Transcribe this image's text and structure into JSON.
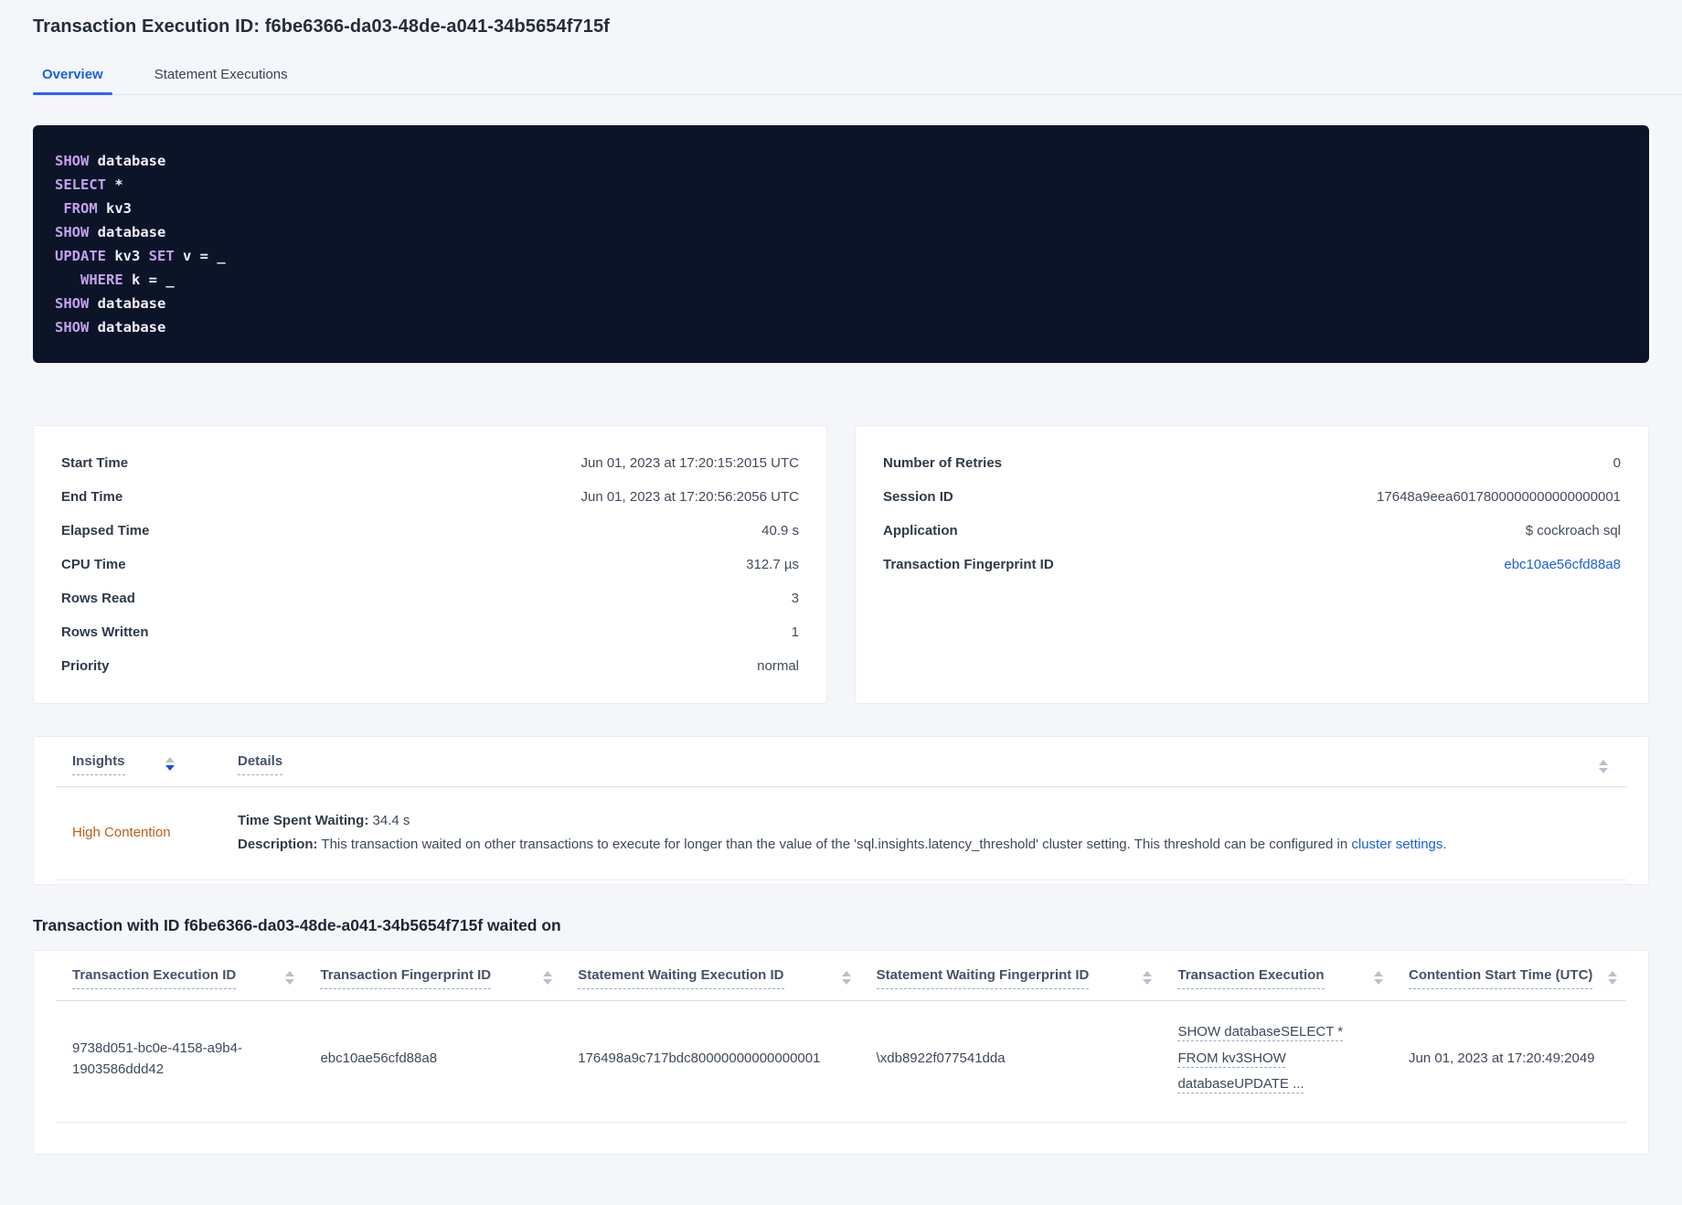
{
  "page": {
    "title": "Transaction Execution ID: f6be6366-da03-48de-a041-34b5654f715f"
  },
  "tabs": {
    "overview": "Overview",
    "statement_executions": "Statement Executions"
  },
  "sql": {
    "lines": [
      [
        {
          "t": "SHOW",
          "k": true
        },
        {
          "t": " database",
          "k": false
        }
      ],
      [
        {
          "t": "SELECT",
          "k": true
        },
        {
          "t": " *",
          "k": false
        }
      ],
      [
        {
          "t": " ",
          "k": false
        },
        {
          "t": "FROM",
          "k": true
        },
        {
          "t": " kv3",
          "k": false
        }
      ],
      [
        {
          "t": "SHOW",
          "k": true
        },
        {
          "t": " database",
          "k": false
        }
      ],
      [
        {
          "t": "UPDATE",
          "k": true
        },
        {
          "t": " kv3 ",
          "k": false
        },
        {
          "t": "SET",
          "k": true
        },
        {
          "t": " v = _",
          "k": false
        }
      ],
      [
        {
          "t": "   ",
          "k": false
        },
        {
          "t": "WHERE",
          "k": true
        },
        {
          "t": " k = _",
          "k": false
        }
      ],
      [
        {
          "t": "SHOW",
          "k": true
        },
        {
          "t": " database",
          "k": false
        }
      ],
      [
        {
          "t": "SHOW",
          "k": true
        },
        {
          "t": " database",
          "k": false
        }
      ]
    ]
  },
  "summary_left": {
    "rows": [
      {
        "label": "Start Time",
        "value": "Jun 01, 2023 at 17:20:15:2015 UTC"
      },
      {
        "label": "End Time",
        "value": "Jun 01, 2023 at 17:20:56:2056 UTC"
      },
      {
        "label": "Elapsed Time",
        "value": "40.9 s"
      },
      {
        "label": "CPU Time",
        "value": "312.7 µs"
      },
      {
        "label": "Rows Read",
        "value": "3"
      },
      {
        "label": "Rows Written",
        "value": "1"
      },
      {
        "label": "Priority",
        "value": "normal"
      }
    ]
  },
  "summary_right": {
    "rows": [
      {
        "label": "Number of Retries",
        "value": "0"
      },
      {
        "label": "Session ID",
        "value": "17648a9eea6017800000000000000001"
      },
      {
        "label": "Application",
        "value": "$ cockroach sql"
      },
      {
        "label": "Transaction Fingerprint ID",
        "value": "ebc10ae56cfd88a8"
      }
    ]
  },
  "insights_table": {
    "columns": {
      "insights": "Insights",
      "details": "Details"
    },
    "row": {
      "insight": "High Contention",
      "time_label": "Time Spent Waiting:",
      "time_value": "34.4 s",
      "desc_label": "Description:",
      "desc_text": " This transaction waited on other transactions to execute for longer than the value of the 'sql.insights.latency_threshold' cluster setting. This threshold can be configured in ",
      "desc_link": "cluster settings",
      "desc_after": "."
    }
  },
  "waited_on": {
    "heading": "Transaction with ID f6be6366-da03-48de-a041-34b5654f715f waited on",
    "columns": [
      "Transaction Execution ID",
      "Transaction Fingerprint ID",
      "Statement Waiting Execution ID",
      "Statement Waiting Fingerprint ID",
      "Transaction Execution",
      "Contention Start Time (UTC)"
    ],
    "rows": [
      {
        "transaction_execution_id": "9738d051-bc0e-4158-a9b4-1903586ddd42",
        "transaction_fingerprint_id": "ebc10ae56cfd88a8",
        "statement_waiting_execution_id": "176498a9c717bdc80000000000000001",
        "statement_waiting_fingerprint_id": "\\xdb8922f077541dda",
        "transaction_execution": "SHOW databaseSELECT * FROM kv3SHOW databaseUPDATE ...",
        "contention_start_time": "Jun 01, 2023 at 17:20:49:2049"
      }
    ]
  },
  "colors": {
    "accent_blue": "#1a61e4",
    "tab_underline_blue": "#2962ff",
    "insight_orange": "#bf5b17",
    "sql_background": "#0c1527",
    "sql_keyword": "#c3a1f0",
    "page_background": "#f4f6fa"
  }
}
